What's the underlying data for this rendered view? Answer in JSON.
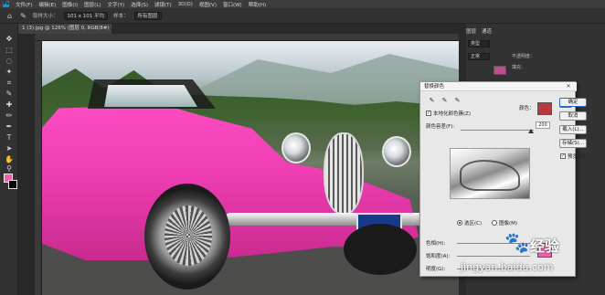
{
  "menubar": {
    "logo": "Ps",
    "items": [
      "文件(F)",
      "编辑(E)",
      "图像(I)",
      "图层(L)",
      "文字(Y)",
      "选择(S)",
      "滤镜(T)",
      "3D(D)",
      "视图(V)",
      "窗口(W)",
      "帮助(H)"
    ]
  },
  "optionsbar": {
    "sample_label": "取样大小：",
    "sample_value": "101 x 101 平均",
    "sample_from_label": "样本：",
    "sample_from_value": "所有图层"
  },
  "document_tab": {
    "title": "1 (3).jpg @ 126% (图层 0, RGB/8#) *"
  },
  "panel": {
    "tabs": [
      "图层",
      "通道"
    ],
    "kind_label": "类型",
    "blend_label": "正常",
    "opacity_label": "不透明度：",
    "fill_label": "填充："
  },
  "dialog": {
    "title": "替换颜色",
    "localized_clusters_label": "本地化颜色簇(Z)",
    "color_label": "颜色：",
    "fuzziness_label": "颜色容差(F):",
    "fuzziness_value": "200",
    "ok_label": "确定",
    "cancel_label": "取消",
    "load_label": "载入(L)...",
    "save_label": "存储(S)...",
    "preview_label": "预览(P)",
    "selection_radio": "选区(C)",
    "image_radio": "图像(M)",
    "hue_label": "色相(H):",
    "saturation_label": "饱和度(A):",
    "lightness_label": "明度(G):",
    "result_label": "结果",
    "colors": {
      "selected": "#b93a3e",
      "result": "#f061a8"
    }
  },
  "watermark": {
    "brand": "经验",
    "url": "jingyan.baidu.com"
  },
  "colors": {
    "foreground": "#f061a8",
    "background": "#000000",
    "car_pink": "#f03fb4"
  }
}
